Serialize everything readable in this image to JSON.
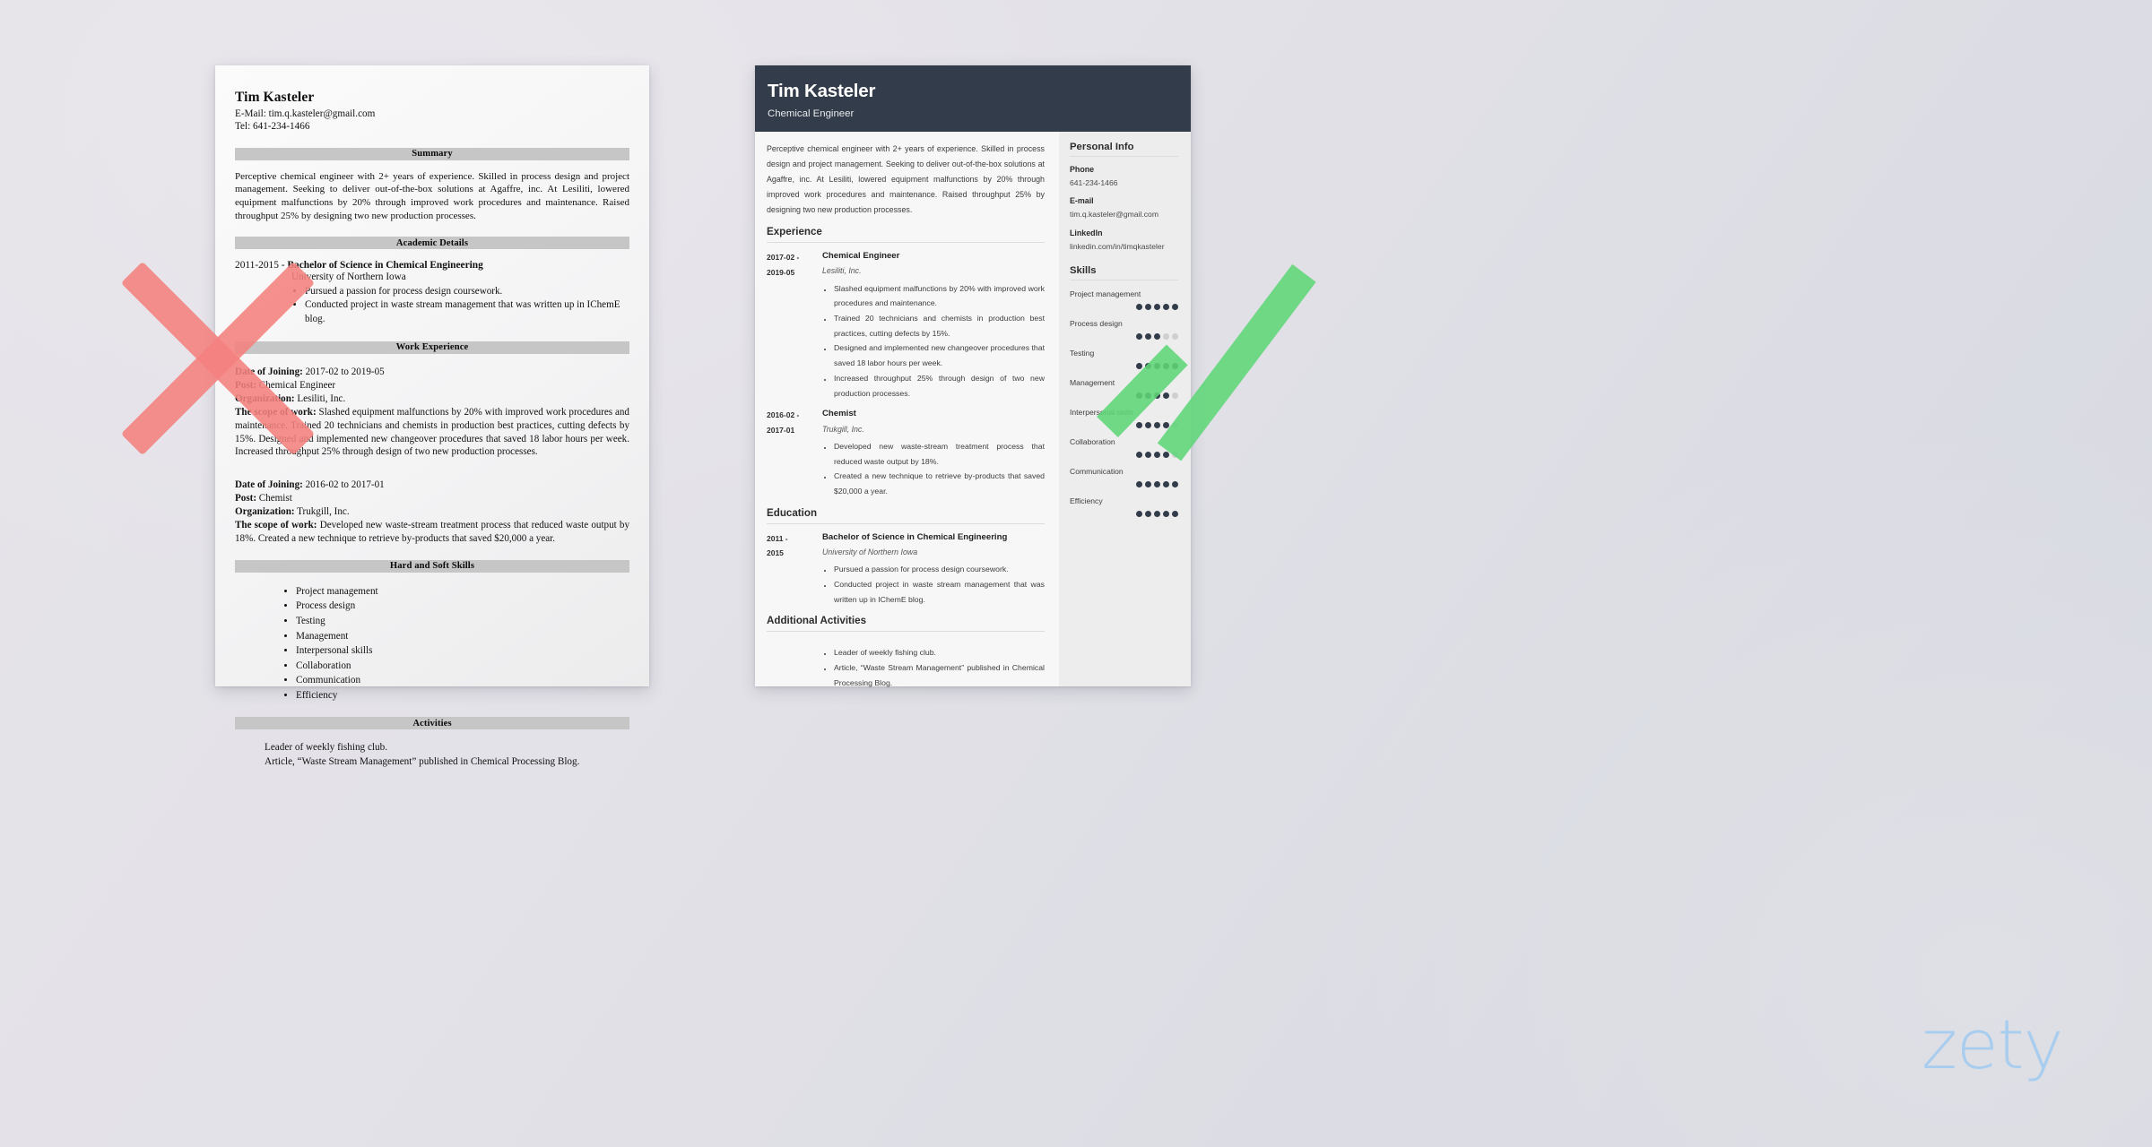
{
  "brand": {
    "watermark": "zety",
    "watermark_color": "#a9cdee"
  },
  "marks": {
    "reject": {
      "name": "red-x-mark",
      "color": "#f4817e"
    },
    "approve": {
      "name": "green-check-mark",
      "color": "#5ed677"
    }
  },
  "bad_resume": {
    "name": "Tim Kasteler",
    "contact": {
      "email_line": "E-Mail: tim.q.kasteler@gmail.com",
      "phone_line": "Tel: 641-234-1466"
    },
    "sections": {
      "summary": {
        "heading": "Summary",
        "text": "Perceptive chemical engineer with 2+ years of experience. Skilled in process design and project management. Seeking to deliver out-of-the-box solutions at Agaffre, inc. At Lesiliti, lowered equipment malfunctions by 20% through improved work procedures and maintenance. Raised throughput 25% by designing two new production processes."
      },
      "academic": {
        "heading": "Academic Details",
        "years": "2011-2015 - ",
        "degree": "Bachelor of Science in Chemical Engineering",
        "school": "University of Northern Iowa",
        "bullets": [
          "Pursued a passion for process design coursework.",
          "Conducted project in waste stream management that was written up in IChemE blog."
        ]
      },
      "work": {
        "heading": "Work Experience",
        "jobs": [
          {
            "date_label": "Date of Joining:",
            "date_value": " 2017-02 to 2019-05",
            "post_label": "Post:",
            "post_value": " Chemical Engineer",
            "org_label": "Organization:",
            "org_value": " Lesiliti, Inc.",
            "scope_label": "The scope of work:",
            "scope_value": " Slashed equipment malfunctions by 20% with improved work procedures and maintenance. Trained 20 technicians and chemists in production best practices, cutting defects by 15%. Designed and implemented new changeover procedures that saved 18 labor hours per week. Increased throughput 25% through design of two new production processes."
          },
          {
            "date_label": "Date of Joining:",
            "date_value": " 2016-02 to 2017-01",
            "post_label": "Post:",
            "post_value": " Chemist",
            "org_label": "Organization:",
            "org_value": " Trukgill, Inc.",
            "scope_label": "The scope of work:",
            "scope_value": " Developed new waste-stream treatment process that reduced waste output by 18%. Created a new technique to retrieve by-products that saved $20,000 a year."
          }
        ]
      },
      "skills": {
        "heading": "Hard and Soft Skills",
        "items": [
          "Project management",
          "Process design",
          "Testing",
          "Management",
          "Interpersonal skills",
          "Collaboration",
          "Communication",
          "Efficiency"
        ]
      },
      "activities": {
        "heading": "Activities",
        "lines": [
          "Leader of weekly fishing club.",
          "Article, “Waste Stream Management” published in Chemical Processing Blog."
        ]
      }
    }
  },
  "good_resume": {
    "header": {
      "name": "Tim Kasteler",
      "job_title": "Chemical Engineer",
      "bg_color": "#333c4a"
    },
    "summary": "Perceptive chemical engineer with 2+ years of experience. Skilled in process design and project management. Seeking to deliver out-of-the-box solutions at Agaffre, inc. At Lesiliti, lowered equipment malfunctions by 20% through improved work procedures and maintenance. Raised throughput 25% by designing two new production processes.",
    "experience": {
      "heading": "Experience",
      "entries": [
        {
          "date_from": "2017-02 -",
          "date_to": "2019-05",
          "role": "Chemical Engineer",
          "org": "Lesiliti, Inc.",
          "bullets": [
            "Slashed equipment malfunctions by 20% with improved work procedures and maintenance.",
            "Trained 20 technicians and chemists in production best practices, cutting defects by 15%.",
            "Designed and implemented new changeover procedures that saved 18 labor hours per week.",
            "Increased throughput 25% through design of two new production processes."
          ]
        },
        {
          "date_from": "2016-02 -",
          "date_to": "2017-01",
          "role": "Chemist",
          "org": "Trukgill, Inc.",
          "bullets": [
            "Developed new waste-stream treatment process that reduced waste output by 18%.",
            "Created a new technique to retrieve by-products that saved $20,000 a year."
          ]
        }
      ]
    },
    "education": {
      "heading": "Education",
      "entries": [
        {
          "date_from": "2011 -",
          "date_to": "2015",
          "role": "Bachelor of Science in Chemical Engineering",
          "org": "University of Northern Iowa",
          "bullets": [
            "Pursued a passion for process design coursework.",
            "Conducted project in waste stream management that was written up in IChemE blog."
          ]
        }
      ]
    },
    "additional": {
      "heading": "Additional Activities",
      "bullets": [
        "Leader of weekly fishing club.",
        "Article, “Waste Stream Management” published in Chemical Processing Blog."
      ]
    },
    "sidebar": {
      "personal_info": {
        "heading": "Personal Info",
        "fields": [
          {
            "label": "Phone",
            "value": "641-234-1466"
          },
          {
            "label": "E-mail",
            "value": "tim.q.kasteler@gmail.com"
          },
          {
            "label": "LinkedIn",
            "value": "linkedin.com/in/timqkasteler"
          }
        ]
      },
      "skills": {
        "heading": "Skills",
        "max_rating": 5,
        "items": [
          {
            "label": "Project management",
            "rating": 5
          },
          {
            "label": "Process design",
            "rating": 3
          },
          {
            "label": "Testing",
            "rating": 5
          },
          {
            "label": "Management",
            "rating": 4
          },
          {
            "label": "Interpersonal skills",
            "rating": 4
          },
          {
            "label": "Collaboration",
            "rating": 4
          },
          {
            "label": "Communication",
            "rating": 5
          },
          {
            "label": "Efficiency",
            "rating": 5
          }
        ]
      }
    }
  }
}
